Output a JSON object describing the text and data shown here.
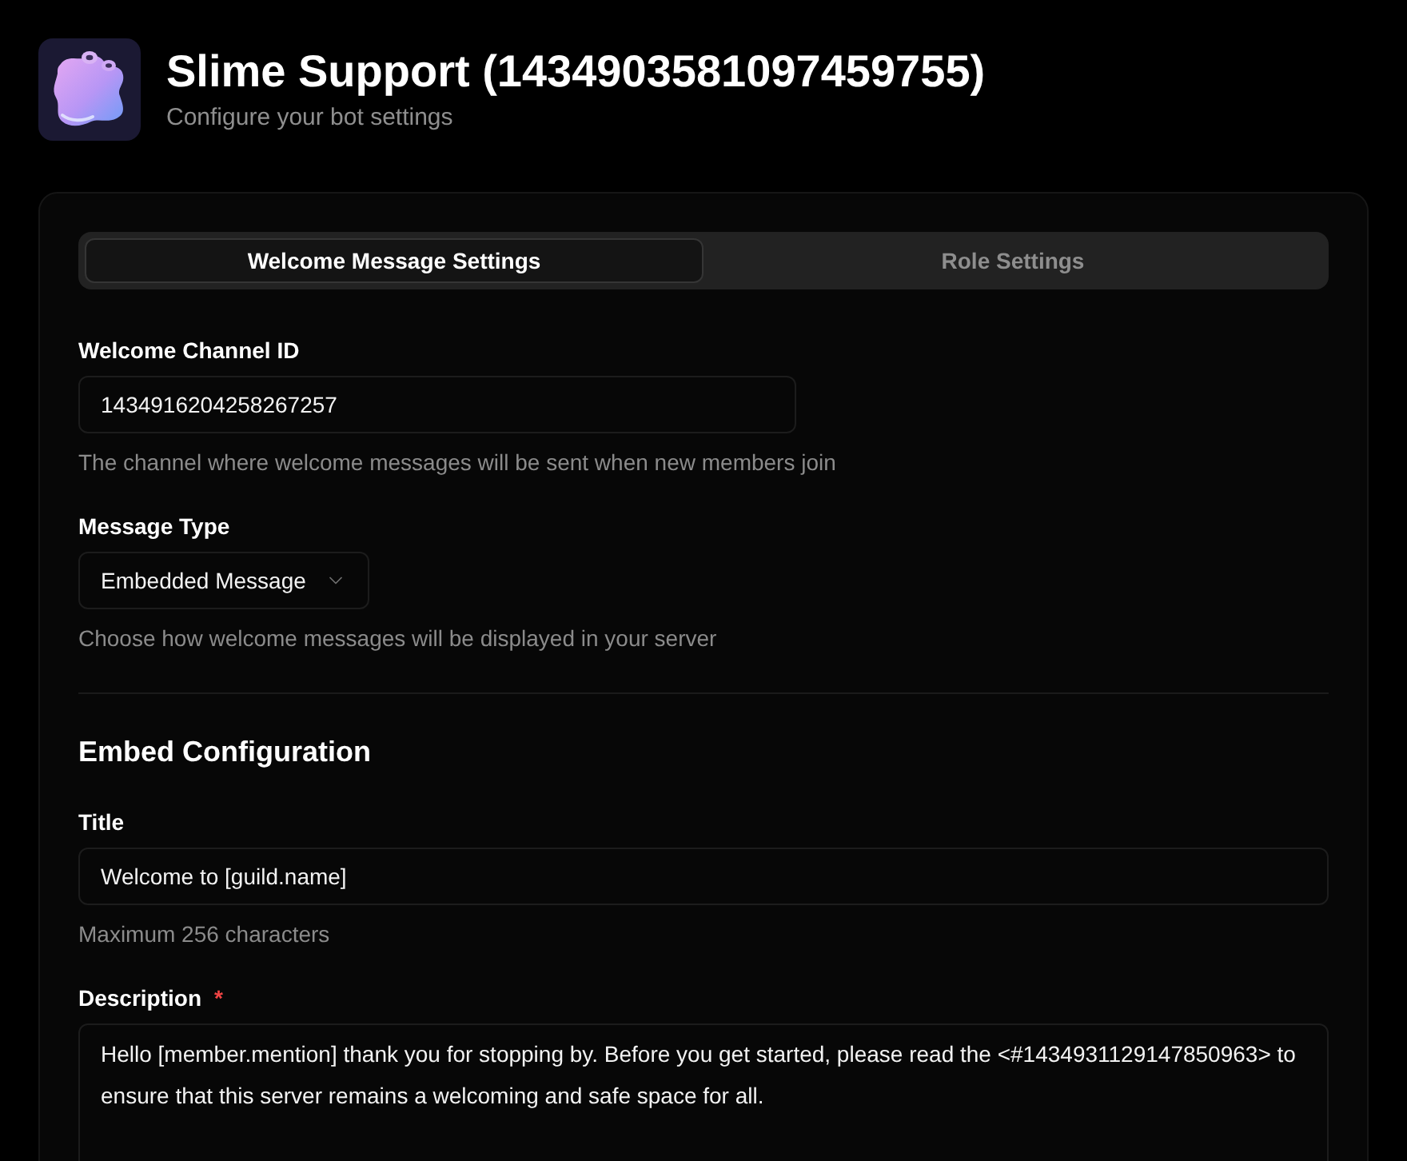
{
  "header": {
    "title": "Slime Support (1434903581097459755)",
    "subtitle": "Configure your bot settings"
  },
  "tabs": [
    {
      "label": "Welcome Message Settings",
      "selected": true
    },
    {
      "label": "Role Settings",
      "selected": false
    }
  ],
  "fields": [
    {
      "kind": "input",
      "label": "Welcome Channel ID",
      "value": "1434916204258267257",
      "hint": "The channel where welcome messages will be sent when new members join"
    },
    {
      "kind": "select",
      "label": "Message Type",
      "value": "Embedded Message",
      "hint": "Choose how welcome messages will be displayed in your server"
    }
  ],
  "embed_configuration": {
    "heading": "Embed Configuration",
    "fields": [
      {
        "kind": "input",
        "label": "Title",
        "value": "Welcome to [guild.name]",
        "hint": "Maximum 256 characters"
      },
      {
        "kind": "textarea",
        "label": "Description",
        "required_mark": "*",
        "value": "Hello [member.mention] thank you for stopping by. Before you get started, please read the <#1434931129147850963> to ensure that this server remains a welcoming and safe space for all."
      }
    ]
  }
}
